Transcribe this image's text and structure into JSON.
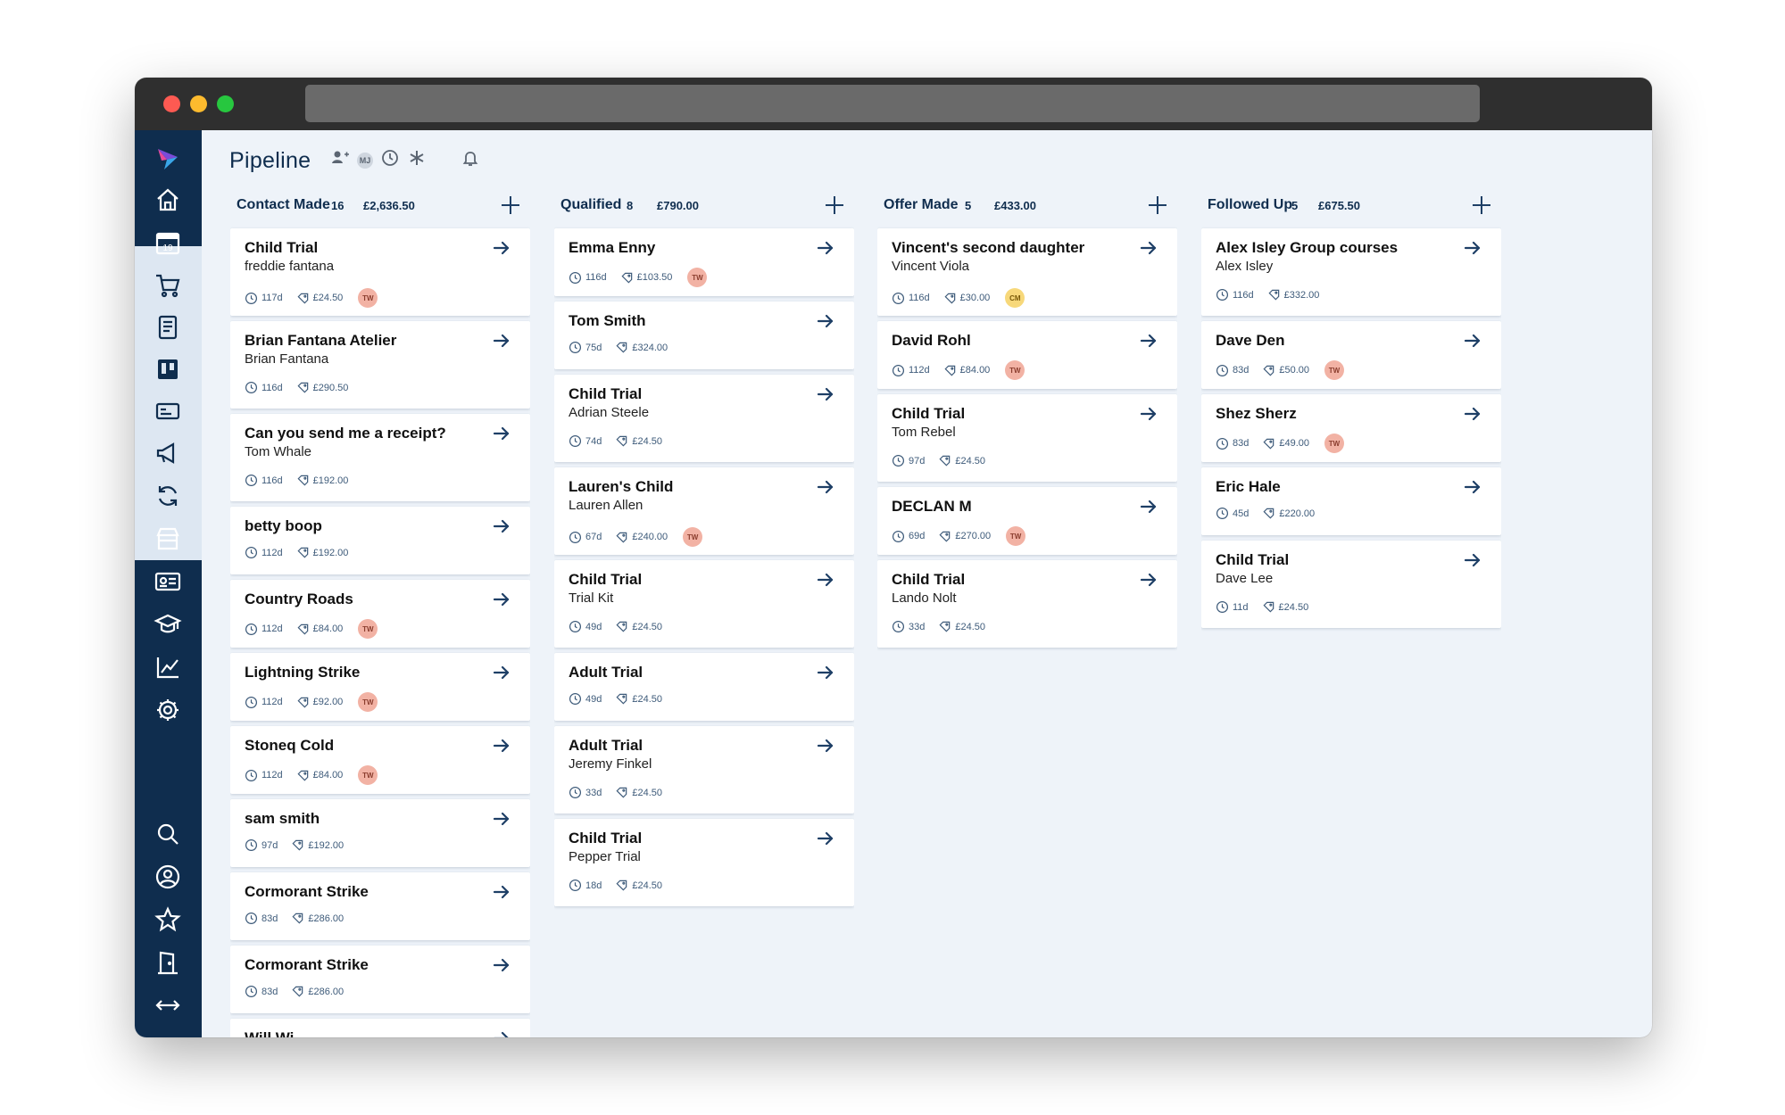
{
  "page": {
    "title": "Pipeline"
  },
  "header": {
    "user_badge": "MJ"
  },
  "colors": {
    "sidebar": "#0f2d4e",
    "accent": "#0f2d4e",
    "avatar_tw": "#f2b2a4",
    "avatar_cm": "#f7d87a"
  },
  "sidebar": {
    "top_icons": [
      "logo-icon",
      "home-icon",
      "calendar-icon",
      "cart-icon",
      "notes-icon",
      "board-icon",
      "card-icon",
      "megaphone-icon",
      "sync-icon",
      "store-icon",
      "id-card-icon",
      "graduation-icon",
      "chart-line-icon",
      "gear-icon"
    ],
    "calendar_day": "19",
    "bottom_icons": [
      "search-icon",
      "user-icon",
      "star-icon",
      "door-icon",
      "expand-icon"
    ]
  },
  "columns": [
    {
      "name": "Contact Made",
      "count": "16",
      "amount": "£2,636.50",
      "cards": [
        {
          "title": "Child Trial",
          "subtitle": "freddie fantana",
          "days": "117d",
          "value": "£24.50",
          "avatar": "TW"
        },
        {
          "title": "Brian Fantana Atelier",
          "subtitle": "Brian Fantana",
          "days": "116d",
          "value": "£290.50",
          "avatar": ""
        },
        {
          "title": "Can you send me a receipt?",
          "subtitle": "Tom Whale",
          "days": "116d",
          "value": "£192.00",
          "avatar": ""
        },
        {
          "title": "betty boop",
          "subtitle": "",
          "days": "112d",
          "value": "£192.00",
          "avatar": ""
        },
        {
          "title": "Country Roads",
          "subtitle": "",
          "days": "112d",
          "value": "£84.00",
          "avatar": "TW"
        },
        {
          "title": "Lightning Strike",
          "subtitle": "",
          "days": "112d",
          "value": "£92.00",
          "avatar": "TW"
        },
        {
          "title": "Stoneq Cold",
          "subtitle": "",
          "days": "112d",
          "value": "£84.00",
          "avatar": "TW"
        },
        {
          "title": "sam smith",
          "subtitle": "",
          "days": "97d",
          "value": "£192.00",
          "avatar": ""
        },
        {
          "title": "Cormorant Strike",
          "subtitle": "",
          "days": "83d",
          "value": "£286.00",
          "avatar": ""
        },
        {
          "title": "Cormorant Strike",
          "subtitle": "",
          "days": "83d",
          "value": "£286.00",
          "avatar": ""
        },
        {
          "title": "Will Wi",
          "subtitle": "",
          "days": "",
          "value": "",
          "avatar": ""
        }
      ]
    },
    {
      "name": "Qualified",
      "count": "8",
      "amount": "£790.00",
      "cards": [
        {
          "title": "Emma Enny",
          "subtitle": "",
          "days": "116d",
          "value": "£103.50",
          "avatar": "TW"
        },
        {
          "title": "Tom Smith",
          "subtitle": "",
          "days": "75d",
          "value": "£324.00",
          "avatar": ""
        },
        {
          "title": "Child Trial",
          "subtitle": "Adrian Steele",
          "days": "74d",
          "value": "£24.50",
          "avatar": ""
        },
        {
          "title": "Lauren's Child",
          "subtitle": "Lauren Allen",
          "days": "67d",
          "value": "£240.00",
          "avatar": "TW"
        },
        {
          "title": "Child Trial",
          "subtitle": "Trial Kit",
          "days": "49d",
          "value": "£24.50",
          "avatar": ""
        },
        {
          "title": "Adult Trial",
          "subtitle": "",
          "days": "49d",
          "value": "£24.50",
          "avatar": ""
        },
        {
          "title": "Adult Trial",
          "subtitle": "Jeremy Finkel",
          "days": "33d",
          "value": "£24.50",
          "avatar": ""
        },
        {
          "title": "Child Trial",
          "subtitle": "Pepper Trial",
          "days": "18d",
          "value": "£24.50",
          "avatar": ""
        }
      ]
    },
    {
      "name": "Offer Made",
      "count": "5",
      "amount": "£433.00",
      "cards": [
        {
          "title": "Vincent's second daughter",
          "subtitle": "Vincent Viola",
          "days": "116d",
          "value": "£30.00",
          "avatar": "CM"
        },
        {
          "title": "David Rohl",
          "subtitle": "",
          "days": "112d",
          "value": "£84.00",
          "avatar": "TW"
        },
        {
          "title": "Child Trial",
          "subtitle": "Tom Rebel",
          "days": "97d",
          "value": "£24.50",
          "avatar": ""
        },
        {
          "title": "DECLAN M",
          "subtitle": "",
          "days": "69d",
          "value": "£270.00",
          "avatar": "TW"
        },
        {
          "title": "Child Trial",
          "subtitle": "Lando Nolt",
          "days": "33d",
          "value": "£24.50",
          "avatar": ""
        }
      ]
    },
    {
      "name": "Followed Up",
      "count": "5",
      "amount": "£675.50",
      "cards": [
        {
          "title": "Alex Isley Group courses",
          "subtitle": "Alex Isley",
          "days": "116d",
          "value": "£332.00",
          "avatar": ""
        },
        {
          "title": "Dave Den",
          "subtitle": "",
          "days": "83d",
          "value": "£50.00",
          "avatar": "TW"
        },
        {
          "title": "Shez Sherz",
          "subtitle": "",
          "days": "83d",
          "value": "£49.00",
          "avatar": "TW"
        },
        {
          "title": "Eric Hale",
          "subtitle": "",
          "days": "45d",
          "value": "£220.00",
          "avatar": ""
        },
        {
          "title": "Child Trial",
          "subtitle": "Dave Lee",
          "days": "11d",
          "value": "£24.50",
          "avatar": ""
        }
      ]
    }
  ]
}
